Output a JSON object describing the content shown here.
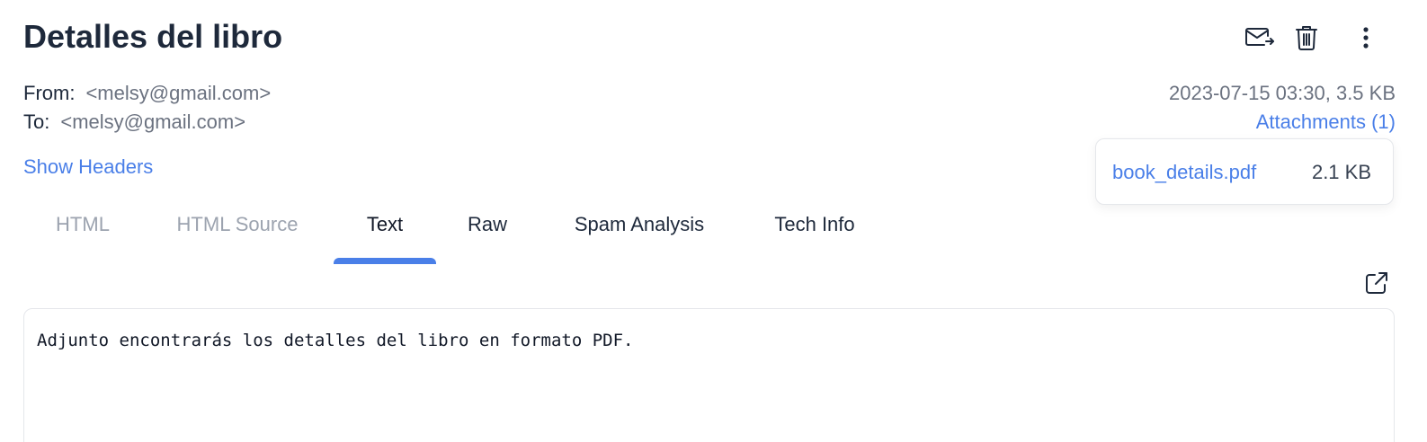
{
  "header": {
    "title": "Detalles del libro"
  },
  "actions": {
    "forward_icon": "forward-mail-icon",
    "delete_icon": "trash-icon",
    "more_icon": "more-vertical-icon"
  },
  "meta": {
    "from_label": "From:",
    "from_address": "<melsy@gmail.com>",
    "to_label": "To:",
    "to_address": "<melsy@gmail.com>",
    "datetime_size": "2023-07-15 03:30, 3.5 KB",
    "attachments_link": "Attachments (1)",
    "show_headers": "Show Headers"
  },
  "attachments": [
    {
      "name": "book_details.pdf",
      "size": "2.1 KB"
    }
  ],
  "tabs": [
    {
      "label": "HTML",
      "state": "disabled"
    },
    {
      "label": "HTML Source",
      "state": "disabled"
    },
    {
      "label": "Text",
      "state": "active"
    },
    {
      "label": "Raw",
      "state": "normal"
    },
    {
      "label": "Spam Analysis",
      "state": "normal"
    },
    {
      "label": "Tech Info",
      "state": "normal"
    }
  ],
  "body": {
    "open_external_icon": "external-link-icon",
    "text": "Adjunto encontrarás los detalles del libro en formato PDF."
  },
  "colors": {
    "accent": "#4a7fe8",
    "title": "#1e293b",
    "muted": "#6b7280",
    "disabled_tab": "#9ca3af"
  }
}
